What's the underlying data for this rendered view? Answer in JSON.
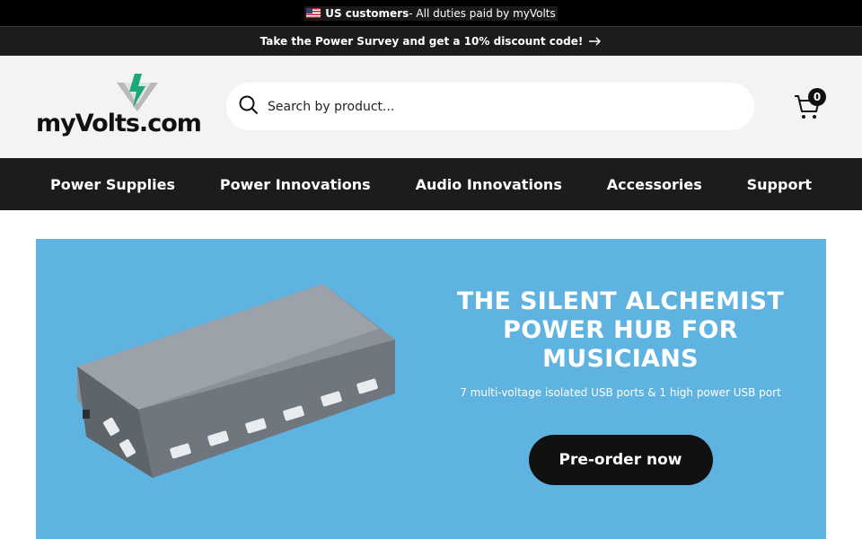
{
  "announcement": {
    "bold": "US customers",
    "rest": " - All duties paid by myVolts"
  },
  "survey": {
    "text": "Take the Power Survey and get a 10% discount code!"
  },
  "header": {
    "logo_text": "myVolts.com",
    "search_placeholder": "Search by product...",
    "cart_count": "0"
  },
  "nav": {
    "items": [
      {
        "label": "Power Supplies"
      },
      {
        "label": "Power Innovations"
      },
      {
        "label": "Audio Innovations"
      },
      {
        "label": "Accessories"
      },
      {
        "label": "Support"
      }
    ]
  },
  "hero": {
    "title": "THE SILENT ALCHEMIST POWER HUB FOR MUSICIANS",
    "subtitle": "7 multi-voltage isolated USB ports & 1 high power USB port",
    "button_label": "Pre-order now"
  },
  "colors": {
    "hero_bg": "#5eb3e0",
    "accent_green": "#1aa77a",
    "dark": "#1c1c1c"
  }
}
